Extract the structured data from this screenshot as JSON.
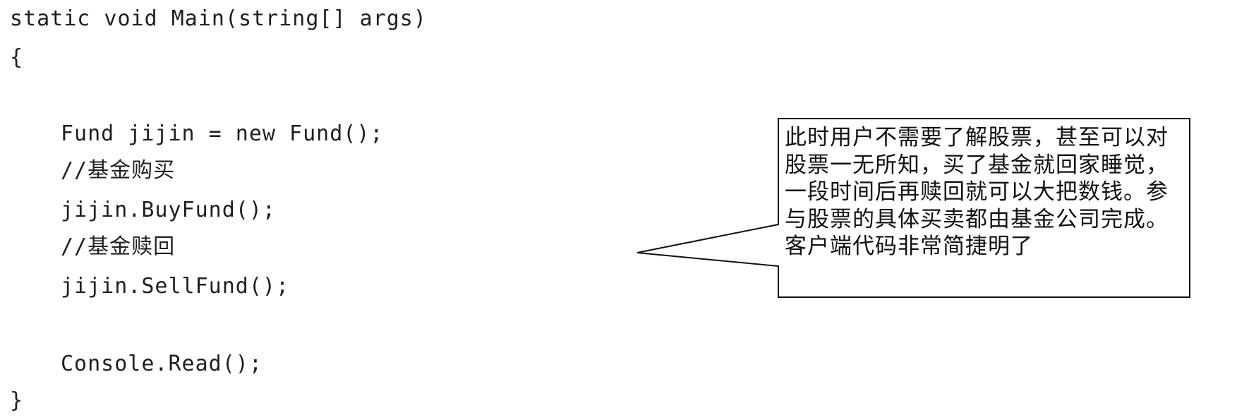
{
  "code": {
    "line1": "static void Main(string[] args)",
    "line2": "{",
    "line3": "Fund jijin = new Fund();",
    "line4": "//基金购买",
    "line5": "jijin.BuyFund();",
    "line6": "//基金赎回",
    "line7": "jijin.SellFund();",
    "line8": "Console.Read();",
    "line9": "}"
  },
  "callout": {
    "text": "此时用户不需要了解股票，甚至可以对股票一无所知，买了基金就回家睡觉，一段时间后再赎回就可以大把数钱。参与股票的具体买卖都由基金公司完成。客户端代码非常简捷明了"
  }
}
